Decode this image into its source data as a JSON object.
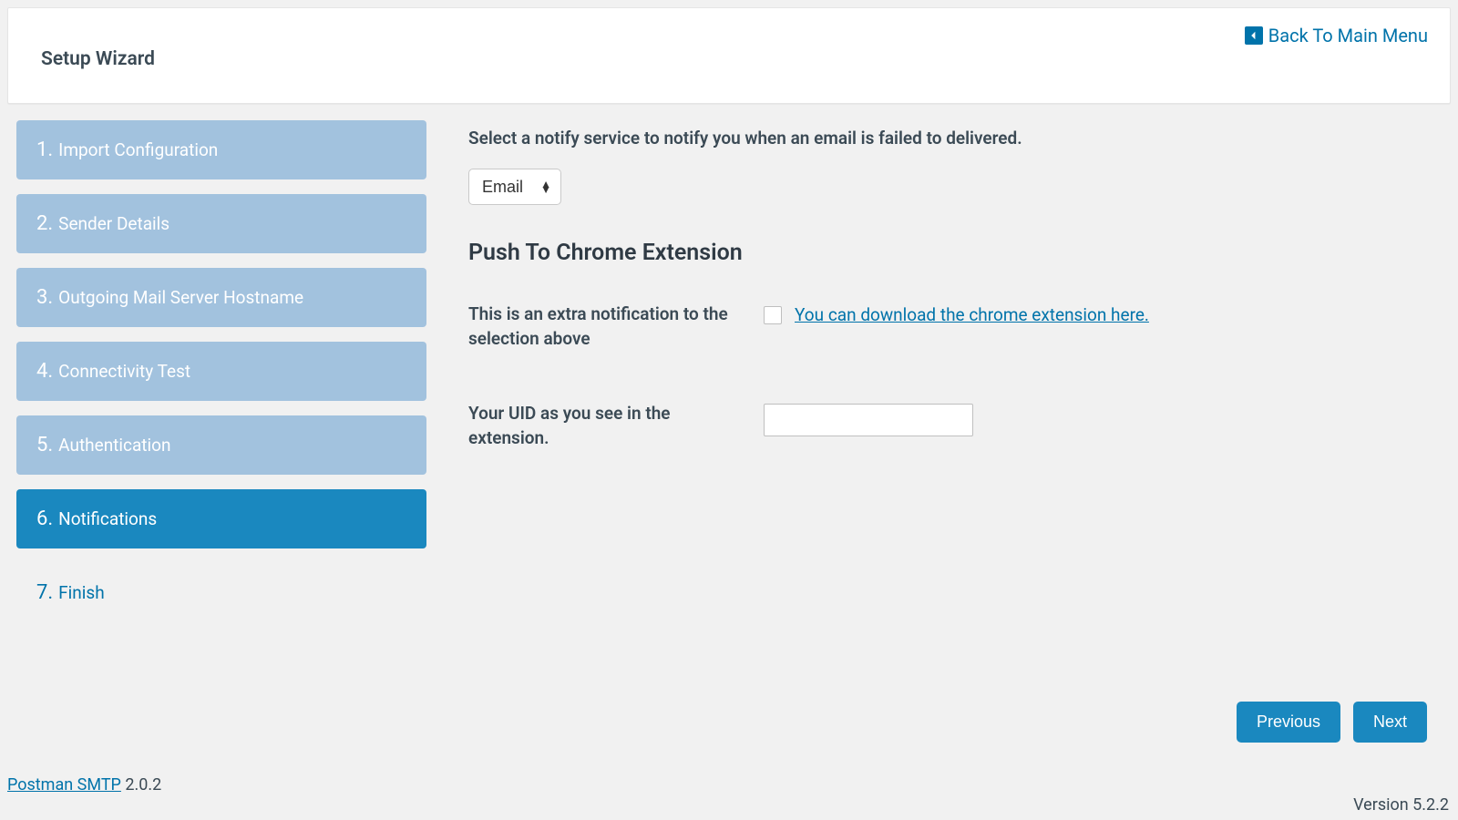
{
  "header": {
    "title": "Setup Wizard",
    "back_label": "Back To Main Menu"
  },
  "steps": [
    {
      "num": "1.",
      "label": "Import Configuration",
      "state": "done"
    },
    {
      "num": "2.",
      "label": "Sender Details",
      "state": "done"
    },
    {
      "num": "3.",
      "label": "Outgoing Mail Server Hostname",
      "state": "done"
    },
    {
      "num": "4.",
      "label": "Connectivity Test",
      "state": "done"
    },
    {
      "num": "5.",
      "label": "Authentication",
      "state": "done"
    },
    {
      "num": "6.",
      "label": "Notifications",
      "state": "active"
    },
    {
      "num": "7.",
      "label": "Finish",
      "state": "upcoming"
    }
  ],
  "main": {
    "intro": "Select a notify service to notify you when an email is failed to delivered.",
    "notify_select": {
      "value": "Email"
    },
    "section_title": "Push To Chrome Extension",
    "extra_label": "This is an extra notification to the selection above",
    "download_link": "You can download the chrome extension here.",
    "uid_label": "Your UID as you see in the extension.",
    "uid_value": ""
  },
  "nav": {
    "previous": "Previous",
    "next": "Next"
  },
  "footer": {
    "product_link": "Postman SMTP",
    "product_version": "2.0.2",
    "wp_version": "Version 5.2.2"
  }
}
